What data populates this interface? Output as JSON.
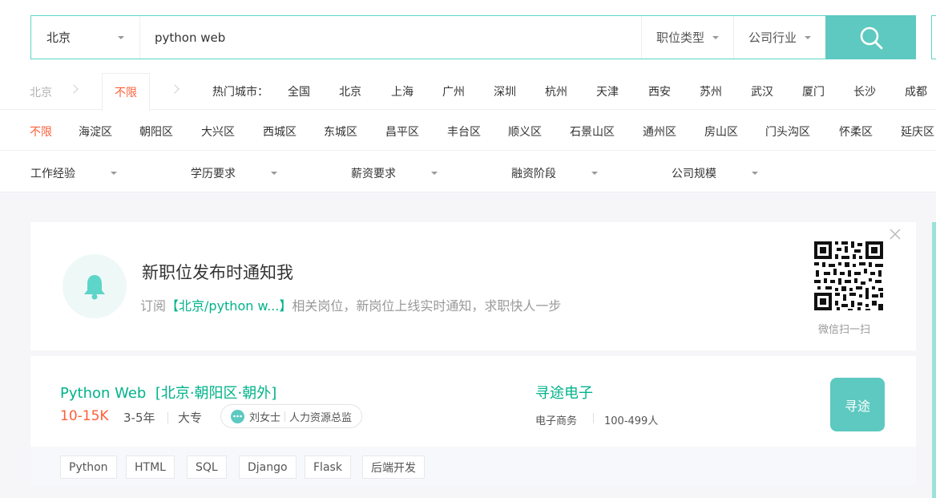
{
  "search": {
    "city": "北京",
    "query": "python web",
    "job_type": "职位类型",
    "industry": "公司行业"
  },
  "city_nav": {
    "current": "北京",
    "unlimited": "不限",
    "hot_label": "热门城市：",
    "cities": [
      "全国",
      "北京",
      "上海",
      "广州",
      "深圳",
      "杭州",
      "天津",
      "西安",
      "苏州",
      "武汉",
      "厦门",
      "长沙",
      "成都"
    ]
  },
  "districts": [
    "不限",
    "海淀区",
    "朝阳区",
    "大兴区",
    "西城区",
    "东城区",
    "昌平区",
    "丰台区",
    "顺义区",
    "石景山区",
    "通州区",
    "房山区",
    "门头沟区",
    "怀柔区",
    "延庆区"
  ],
  "filters": [
    "工作经验",
    "学历要求",
    "薪资要求",
    "融资阶段",
    "公司规模"
  ],
  "notify": {
    "title": "新职位发布时通知我",
    "desc_prefix": "订阅",
    "desc_highlight": "【北京/python w...】",
    "desc_suffix": "相关岗位，新岗位上线实时通知，求职快人一步",
    "qr_label": "微信扫一扫"
  },
  "job": {
    "title": "Python Web",
    "location": "[北京·朝阳区·朝外]",
    "salary": "10-15K",
    "experience": "3-5年",
    "education": "大专",
    "recruiter_name": "刘女士",
    "recruiter_title": "人力资源总监",
    "company": "寻途电子",
    "industry": "电子商务",
    "size": "100-499人",
    "logo_text": "寻途",
    "tags": [
      "Python",
      "HTML",
      "SQL",
      "Django",
      "Flask",
      "后端开发"
    ]
  },
  "colors": {
    "brand": "#5dc9c0",
    "link": "#00b38a",
    "salary": "#fd5f39"
  }
}
